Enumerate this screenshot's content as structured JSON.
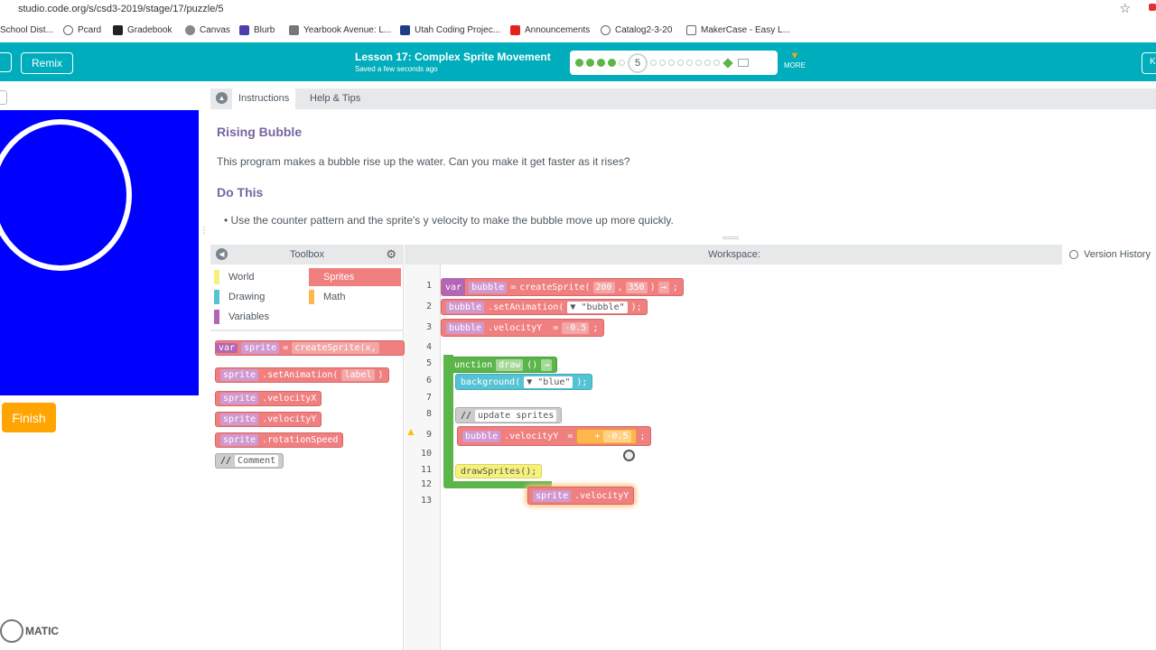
{
  "browser": {
    "url": "studio.code.org/s/csd3-2019/stage/17/puzzle/5",
    "bookmarks": [
      "School Dist...",
      "Pcard",
      "Gradebook",
      "Canvas",
      "Blurb",
      "Yearbook Avenue: L...",
      "Utah Coding Projec...",
      "Announcements",
      "Catalog2-3-20",
      "MakerCase - Easy L..."
    ]
  },
  "header": {
    "remix_label": "Remix",
    "lesson_title": "Lesson 17: Complex Sprite Movement",
    "saved_text": "Saved a few seconds ago",
    "current_level": "5",
    "more_label": "MORE",
    "right_button": "K"
  },
  "stage": {
    "finish_label": "Finish",
    "logo_text": "MATIC"
  },
  "instructions": {
    "tab_instructions": "Instructions",
    "tab_help": "Help & Tips",
    "heading": "Rising Bubble",
    "body": "This program makes a bubble rise up the water. Can you make it get faster as it rises?",
    "do_this_heading": "Do This",
    "bullet": "Use the counter pattern and the sprite's y velocity to make the bubble move up more quickly."
  },
  "toolbox": {
    "title": "Toolbox",
    "categories": [
      "World",
      "Sprites",
      "Drawing",
      "Math",
      "Variables"
    ],
    "blocks": [
      "var",
      "sprite",
      "=",
      "createSprite(x,",
      "sprite",
      ".setAnimation(",
      "label",
      ")",
      "sprite",
      ".velocityX",
      "sprite",
      ".velocityY",
      "sprite",
      ".rotationSpeed",
      "//",
      "Comment"
    ]
  },
  "workspace": {
    "title": "Workspace:",
    "version_history": "Version History",
    "line_numbers": [
      "1",
      "2",
      "3",
      "4",
      "5",
      "6",
      "7",
      "8",
      "9",
      "10",
      "11",
      "12",
      "13"
    ],
    "code": {
      "var_kw": "var",
      "bubble_var": "bubble",
      "eq": "=",
      "create_fn": "createSprite(",
      "x_arg": "200",
      "comma": ",",
      "y_arg": "350",
      "close": ")",
      "arrow": "→",
      "semicolon": ";",
      "set_anim_obj": "bubble",
      "set_anim_fn": ".setAnimation(",
      "anim_value": "\"bubble\"",
      "set_anim_end": ");",
      "vel_obj": "bubble",
      "vel_prop": ".velocityY",
      "vel_value": "-0.5",
      "fn_kw": "function",
      "fn_name": "draw",
      "fn_parens": "()",
      "bg_fn": "background(",
      "bg_value": "\"blue\"",
      "bg_end": ");",
      "comment_slashes": "//",
      "comment_text": "update sprites",
      "line9_obj": "bubble",
      "line9_prop": ".velocityY",
      "line9_plus": "+",
      "line9_value": "-0.5",
      "draw_sprites": "drawSprites();",
      "dragging_obj": "sprite",
      "dragging_prop": ".velocityY"
    }
  }
}
